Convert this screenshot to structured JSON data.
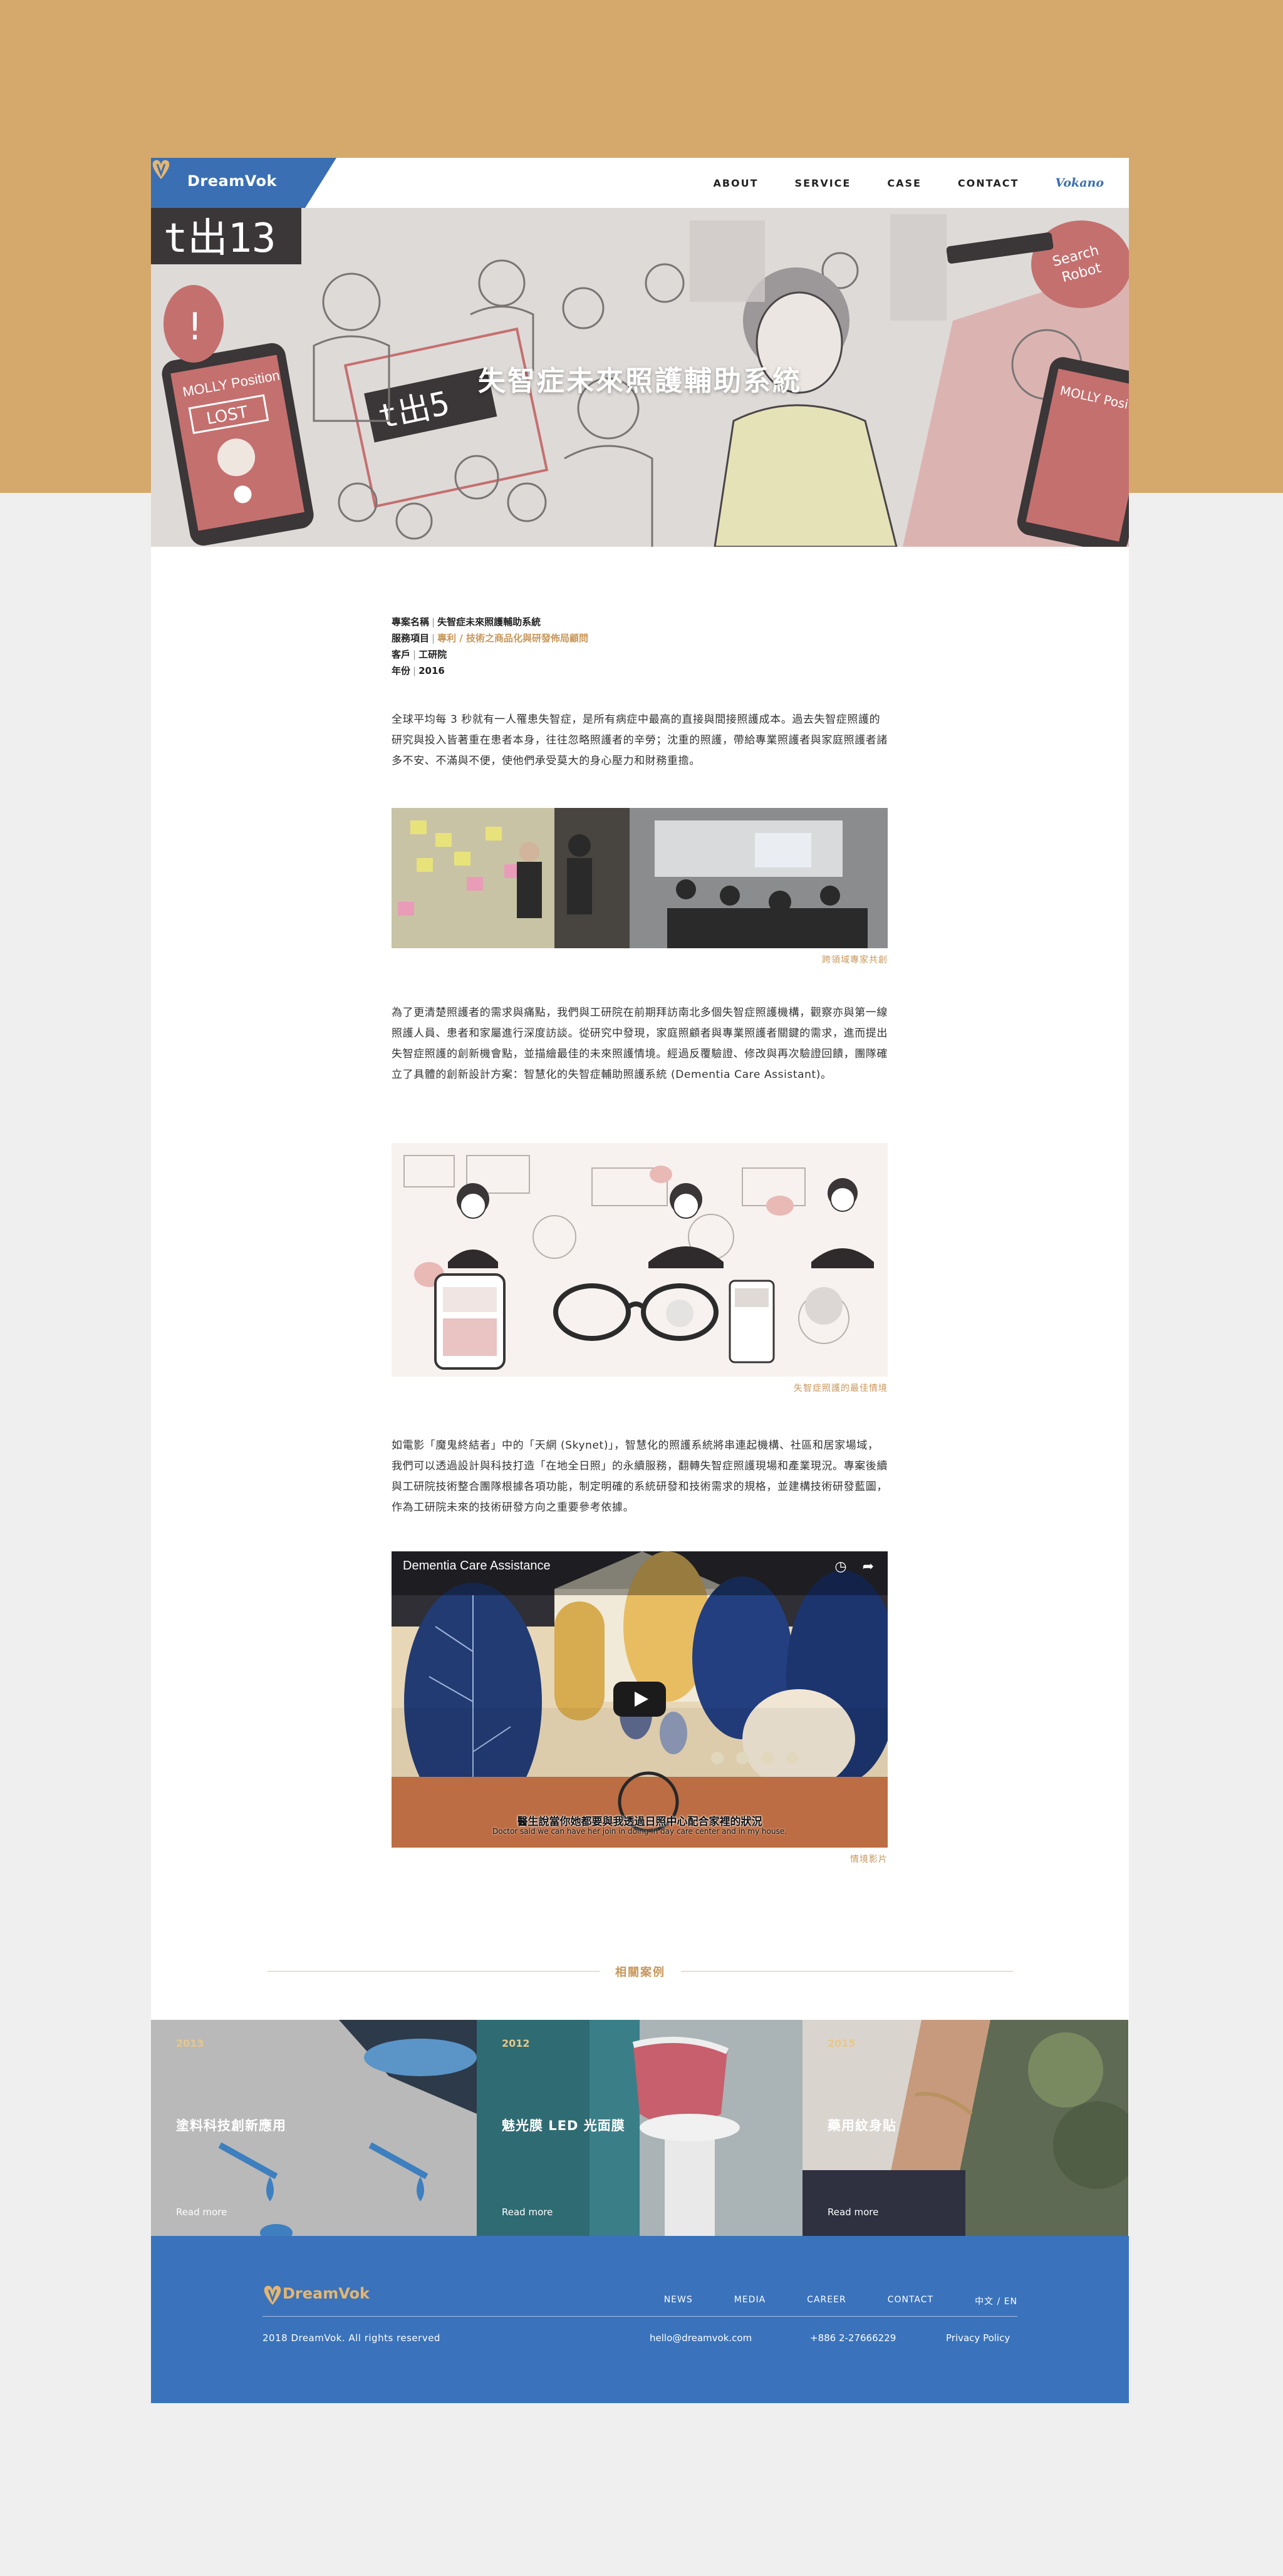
{
  "colors": {
    "gold": "#d4a96b",
    "accent": "#c8975a",
    "blue": "#3a73bc",
    "logo_blue": "#3a6fb4"
  },
  "header": {
    "logo_text": "DreamVok",
    "nav": [
      "ABOUT",
      "SERVICE",
      "CASE",
      "CONTACT"
    ],
    "brand": "Vokano"
  },
  "hero": {
    "title": "失智症未來照護輔助系統"
  },
  "meta": {
    "rows": [
      {
        "key": "專案名稱",
        "value": "失智症未來照護輔助系統"
      },
      {
        "key": "服務項目",
        "value": "專利 / 技術之商品化與研發佈局顧問"
      },
      {
        "key": "客戶",
        "value": "工研院"
      },
      {
        "key": "年份",
        "value": "2016"
      }
    ]
  },
  "article": {
    "p1": "全球平均每 3 秒就有一人罹患失智症，是所有病症中最高的直接與間接照護成本。過去失智症照護的研究與投入皆著重在患者本身，往往忽略照護者的辛勞；沈重的照護，帶給專業照護者與家庭照護者諸多不安、不滿與不便，使他們承受莫大的身心壓力和財務重擔。",
    "caption1": "跨領域專家共創",
    "p2": "為了更清楚照護者的需求與痛點，我們與工研院在前期拜訪南北多個失智症照護機構，觀察亦與第一線照護人員、患者和家屬進行深度訪談。從研究中發現，家庭照顧者與專業照護者關鍵的需求，進而提出失智症照護的創新機會點，並描繪最佳的未來照護情境。經過反覆驗證、修改與再次驗證回饋，團隊確立了具體的創新設計方案：智慧化的失智症輔助照護系統 (Dementia Care Assistant)。",
    "caption2": "失智症照護的最佳情境",
    "p3": "如電影「魔鬼終結者」中的「天網 (Skynet)」，智慧化的照護系統將串連起機構、社區和居家場域，我們可以透過設計與科技打造「在地全日照」的永續服務，翻轉失智症照護現場和產業現況。專案後續與工研院技術整合團隊根據各項功能，制定明確的系統研發和技術需求的規格，並建構技術研發藍圖，作為工研院未來的技術研發方向之重要參考依據。",
    "video_title": "Dementia Care Assistance",
    "video_sub_zh": "醫生說當你她都要與我透過日照中心配合家裡的狀況",
    "video_sub_en": "Doctor said we can have her join in doing in day care center and in my house.",
    "caption3": "情境影片"
  },
  "related": {
    "label": "相關案例",
    "cards": [
      {
        "year": "2013",
        "title": "塗料科技創新應用",
        "more": "Read more"
      },
      {
        "year": "2012",
        "title": "魅光膜 LED 光面膜",
        "more": "Read more"
      },
      {
        "year": "2015",
        "title": "藥用紋身貼",
        "more": "Read more"
      }
    ]
  },
  "footer": {
    "logo_text": "DreamVok",
    "links": [
      "NEWS",
      "MEDIA",
      "CAREER",
      "CONTACT",
      "中文 / EN"
    ],
    "copyright": "2018 DreamVok. All rights reserved",
    "email": "hello@dreamvok.com",
    "phone": "+886 2-27666229",
    "privacy": "Privacy Policy"
  }
}
